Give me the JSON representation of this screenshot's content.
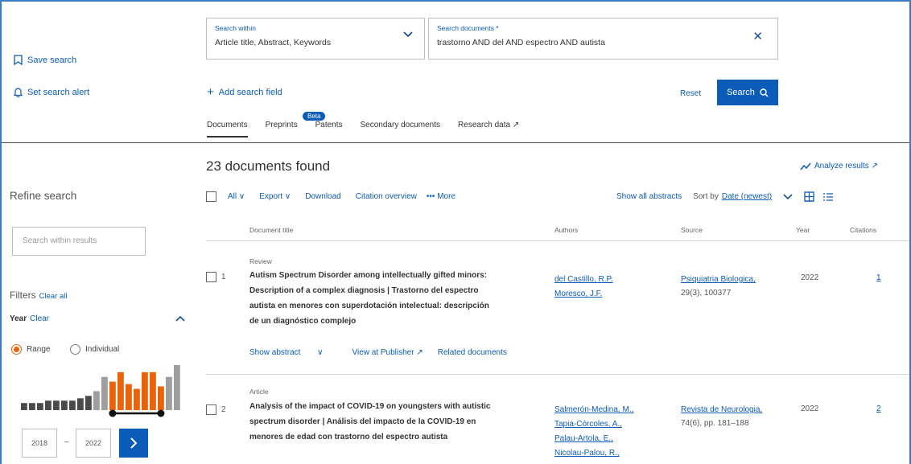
{
  "sidebar_top": {
    "save_search": "Save search",
    "set_alert": "Set search alert"
  },
  "search": {
    "within_label": "Search within",
    "within_value": "Article title, Abstract, Keywords",
    "docs_label": "Search documents *",
    "docs_value": "trastorno AND del AND espectro AND autista",
    "add_field": "Add search field",
    "reset": "Reset",
    "search_button": "Search"
  },
  "tabs": [
    "Documents",
    "Preprints",
    "Patents",
    "Secondary documents",
    "Research data ↗"
  ],
  "beta_badge": "Beta",
  "refine": {
    "title": "Refine search",
    "within_placeholder": "Search within results",
    "filters": "Filters",
    "filters_clear": "Clear all",
    "year": "Year",
    "year_clear": "Clear",
    "range": "Range",
    "individual": "Individual",
    "year_from": "2018",
    "year_dash": "–",
    "year_to": "2022"
  },
  "histogram": {
    "values": [
      3,
      3,
      3,
      4,
      4,
      4,
      4,
      5,
      6,
      8,
      14,
      12,
      16,
      11,
      9,
      16,
      16,
      10,
      14,
      19
    ],
    "selected_from_index": 11,
    "selected_to_index": 17,
    "colors": {
      "selected": "#e8630a",
      "unselected": "#9e9e9e",
      "base": "#4a4a4a"
    }
  },
  "results": {
    "count": "23 documents found",
    "analyze": "Analyze results ↗",
    "toolbar": {
      "all": "All",
      "export": "Export",
      "download": "Download",
      "citation": "Citation overview",
      "more": "More"
    },
    "show_abstracts": "Show all abstracts",
    "sort_by": "Sort by",
    "sort_value": "Date (newest)",
    "columns": {
      "title": "Document title",
      "authors": "Authors",
      "source": "Source",
      "year": "Year",
      "citations": "Citations"
    },
    "rows": [
      {
        "index": "1",
        "type": "Review",
        "title_lines": [
          "Autism Spectrum Disorder among intellectually gifted minors:",
          "Description of a complex diagnosis | Trastorno del espectro",
          "autista en menores con superdotación intelectual: descripción",
          "de un diagnóstico complejo"
        ],
        "authors": [
          "del Castillo, R.P.",
          "Moresco, J.F."
        ],
        "source_name": "Psiquiatria Biologica,",
        "source_detail": "29(3), 100377",
        "year": "2022",
        "citations": "1",
        "links": [
          "Show abstract",
          "View at Publisher ↗",
          "Related documents"
        ]
      },
      {
        "index": "2",
        "type": "Article",
        "title_lines": [
          "Analysis of the impact of COVID-19 on youngsters with autistic",
          "spectrum disorder | Análisis del impacto de la COVID-19 en",
          "menores de edad con trastorno del espectro autista"
        ],
        "authors": [
          "Salmerón-Medina, M.,",
          "Tapia-Córcoles, A.,",
          "Palau-Artola, E.,",
          "Nicolau-Palou, R.,"
        ],
        "source_name": "Revista de Neurologia,",
        "source_detail": "74(6), pp. 181–188",
        "year": "2022",
        "citations": "2"
      }
    ]
  }
}
